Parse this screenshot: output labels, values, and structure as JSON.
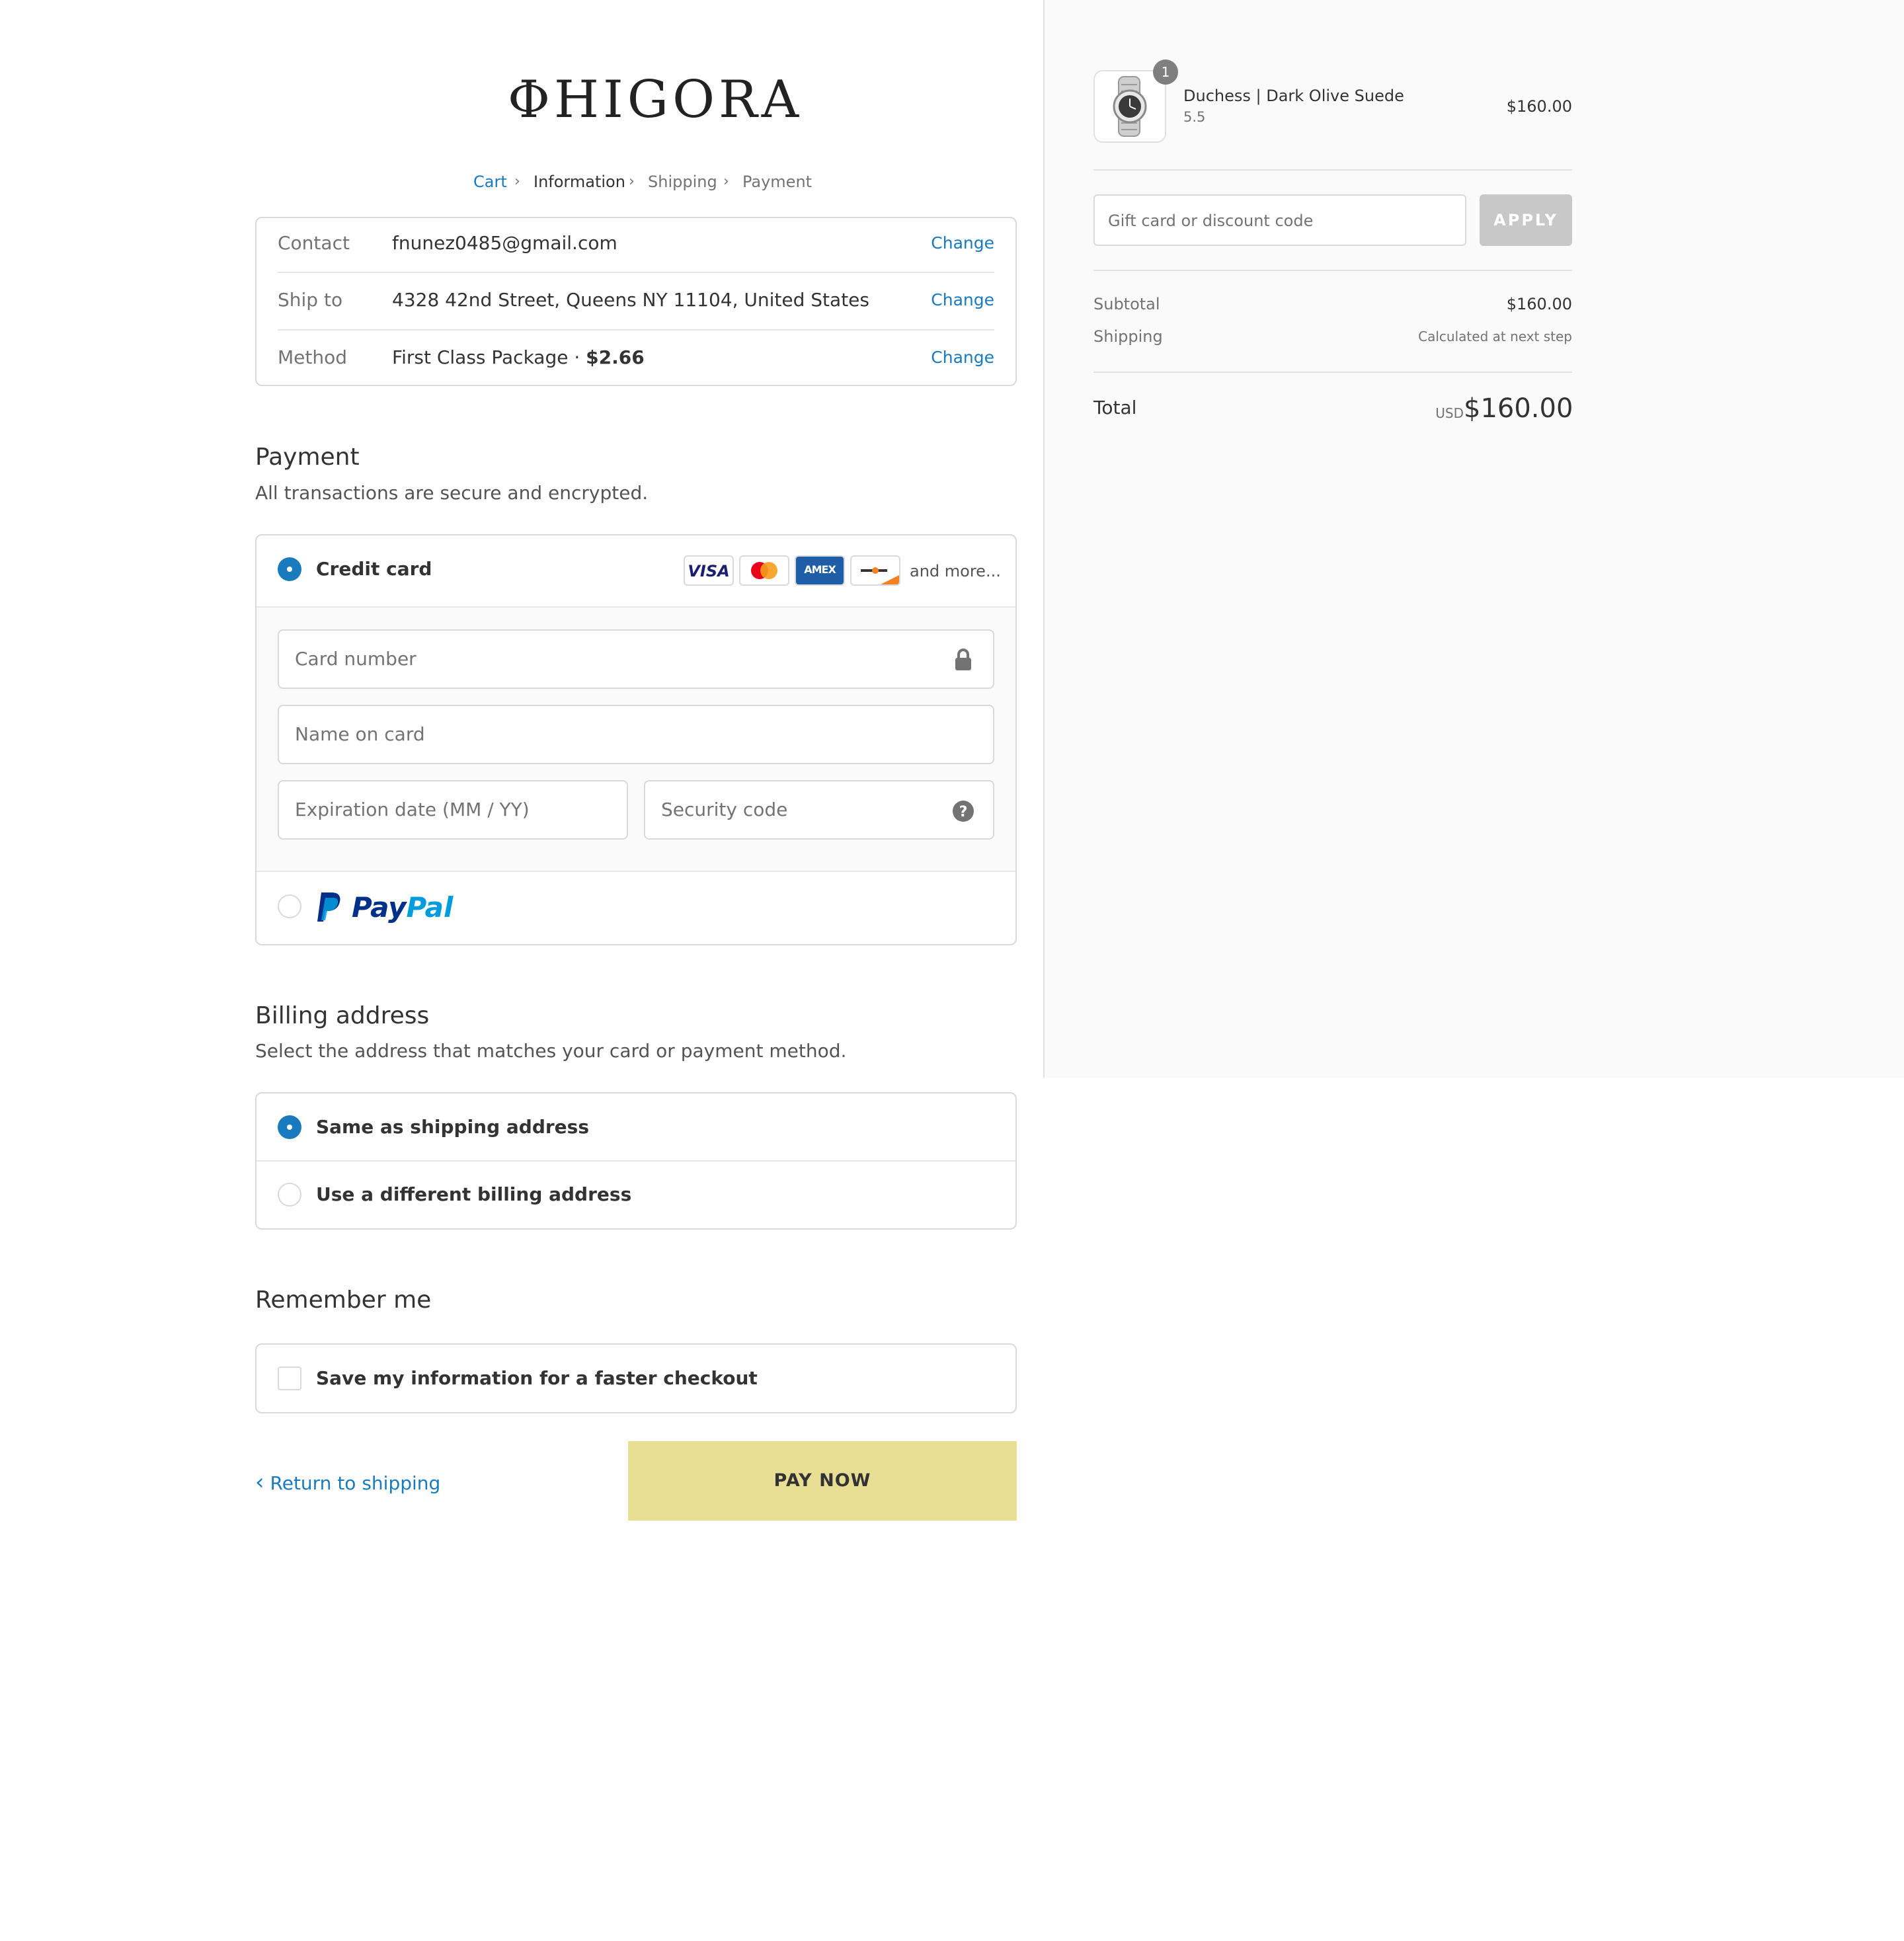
{
  "brand": {
    "logo_text": "ΦHIGORA"
  },
  "breadcrumb": {
    "items": [
      "Cart",
      "Information",
      "Shipping",
      "Payment"
    ],
    "separator": "›"
  },
  "review": {
    "rows": [
      {
        "label": "Contact",
        "value": "fnunez0485@gmail.com",
        "action": "Change"
      },
      {
        "label": "Ship to",
        "value": "4328 42nd Street, Queens NY 11104, United States",
        "action": "Change"
      },
      {
        "label": "Method",
        "value": "First Class Package · ",
        "value_bold": "$2.66",
        "action": "Change"
      }
    ]
  },
  "payment": {
    "title": "Payment",
    "subtitle": "All transactions are secure and encrypted.",
    "credit_card_label": "Credit card",
    "card_brands": [
      "VISA",
      "Mastercard",
      "AMEX",
      "Discover"
    ],
    "and_more": "and more...",
    "fields": {
      "card_number": "Card number",
      "name_on_card": "Name on card",
      "expiration": "Expiration date (MM / YY)",
      "security_code": "Security code"
    },
    "paypal_label": {
      "pay": "Pay",
      "pal": "Pal"
    }
  },
  "billing": {
    "title": "Billing address",
    "subtitle": "Select the address that matches your card or payment method.",
    "options": [
      "Same as shipping address",
      "Use a different billing address"
    ]
  },
  "remember": {
    "title": "Remember me",
    "checkbox_label": "Save my information for a faster checkout"
  },
  "actions": {
    "back": "Return to shipping",
    "back_icon": "‹",
    "pay_now": "PAY NOW"
  },
  "summary": {
    "product": {
      "name": "Duchess | Dark Olive Suede",
      "variant": "5.5",
      "price": "$160.00",
      "quantity": "1"
    },
    "discount_placeholder": "Gift card or discount code",
    "apply_label": "APPLY",
    "subtotal_label": "Subtotal",
    "subtotal_value": "$160.00",
    "shipping_label": "Shipping",
    "shipping_value": "Calculated at next step",
    "total_label": "Total",
    "currency": "USD",
    "total_value": "$160.00"
  },
  "colors": {
    "accent": "#197bbd",
    "pay_button": "#e8df95",
    "sidebar_bg": "#fafafa",
    "apply_button": "#c8c8c8"
  }
}
